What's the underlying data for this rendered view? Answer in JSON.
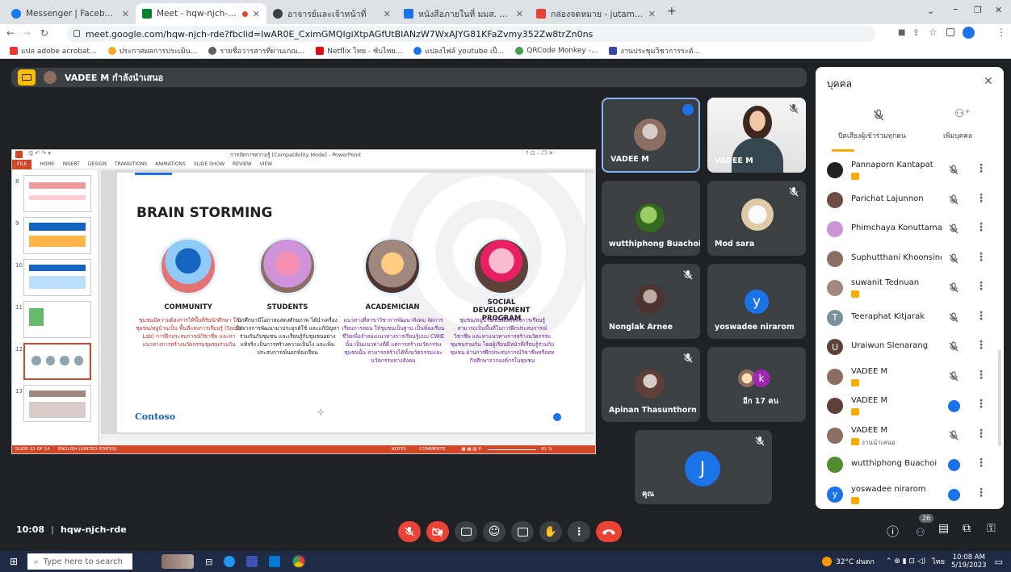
{
  "browser": {
    "tabs": [
      {
        "label": "Messenger | Facebook",
        "icon": "messenger-icon",
        "color": "#1877f2"
      },
      {
        "label": "Meet - hqw-njch-rde",
        "icon": "meet-icon",
        "color": "#00832d"
      },
      {
        "label": "อาจารย์และเจ้าหน้าที่",
        "icon": "site-icon",
        "color": "#3c4043"
      },
      {
        "label": "หนังสือภายในที่ มมส. 0733/2566 (คณ",
        "icon": "doc-icon",
        "color": "#1a73e8"
      },
      {
        "label": "กล่องจดหมาย - jutamas.chu@pcru",
        "icon": "gmail-icon",
        "color": "#ea4335"
      }
    ],
    "url": "meet.google.com/hqw-njch-rde?fbclid=IwAR0E_CximGMQlgiXtpAGfUtBIANzW7WxAJYG81KFaZvmy352Zw8trZn0ns",
    "bookmarks": [
      {
        "label": "แปล adobe acrobat...",
        "color": "#e53935"
      },
      {
        "label": "ประกาศผลการประเมิน...",
        "color": "#f9a825"
      },
      {
        "label": "รายชื่อวารสารที่ผ่านเกณ...",
        "color": "#616161"
      },
      {
        "label": "Netflix ไทย - ซับไทย...",
        "color": "#e50914"
      },
      {
        "label": "แปลงไฟล์ youtube เป็...",
        "color": "#1a73e8"
      },
      {
        "label": "QRCode Monkey -...",
        "color": "#43a047"
      },
      {
        "label": "งานประชุมวิชาการระดั...",
        "color": "#3949ab"
      }
    ]
  },
  "meet": {
    "presenter_label": "VADEE M กำลังนำเสนอ",
    "time": "10:08",
    "meeting_code": "hqw-njch-rde",
    "participant_count": "26",
    "tiles": [
      {
        "name": "VADEE M",
        "color": "#8d6e63"
      },
      {
        "name": "VADEE M",
        "color": "#5d4037"
      },
      {
        "name": "wutthiphong Buachoi",
        "color": "#558b2f"
      },
      {
        "name": "Mod sara",
        "color": "#e0c9a6"
      },
      {
        "name": "Nonglak Arnee",
        "color": "#6d4c41"
      },
      {
        "name": "yoswadee nirarom",
        "initial": "y",
        "color": "#1a73e8"
      },
      {
        "name": "Apinan Thasunthorn",
        "color": "#795548"
      },
      {
        "name": "อีก 17 คน",
        "initial": "k",
        "color": "#9c27b0"
      },
      {
        "name": "คุณ",
        "initial": "J",
        "color": "#1a73e8"
      }
    ]
  },
  "slide": {
    "window_title": "การจัดการความรู้ [Compatibility Mode] - PowerPoint",
    "ribbon": [
      "FILE",
      "HOME",
      "INSERT",
      "DESIGN",
      "TRANSITIONS",
      "ANIMATIONS",
      "SLIDE SHOW",
      "REVIEW",
      "VIEW"
    ],
    "thumb_numbers": [
      "8",
      "9",
      "10",
      "11",
      "12",
      "13"
    ],
    "title": "BRAIN STORMING",
    "columns": [
      {
        "heading": "COMMUNITY",
        "text": "ชุมชนมีความต้องการให้พื้นที่รับนักศึกษา ให้ชุมชน/หมู่บ้านเป็น พื้นที่แห่งการเรียนรู้ (Social Lab) การฝึกประสบการณ์วิชาชีพ และหาแนวทางการสร้างนวัตกรรมชุมชนร่วมกัน",
        "color": "#c62828"
      },
      {
        "heading": "STUDENTS",
        "text": "นักศึกษามีโอกาสแสดงศักยภาพ ได้นำเครื่องมือจากการพัฒนามาประยุกต์ใช้ และแก้ปัญหาร่วมกันกับชุมชน และเรียนรู้กับชุมชนอย่างแท้จริง เป็นการสร้างความเป็นไง และเพิ่มประสบการณ์นอกห้องเรียน",
        "color": "#202124"
      },
      {
        "heading": "ACADEMICIAN",
        "text": "แนวทางที่สาขาวิชาการพัฒนาสังคม จัดการเรียนการสอน ให้ชุมชนเป็นฐาน เป็นห้องเรียนชีวิตเพื่อจำลองแนวทางการเรียนรู้แบบ CWIE นั้น เป็นแนวทางที่ดี แต่การสร้างนวัตกรรมชุมชนนั้น สามารถสร้างได้ทั้งนวัตกรรมและนวัตกรรมทางสังคม",
        "color": "#6a1b9a"
      },
      {
        "heading": "SOCIAL DEVELOPMENT PROGRAM",
        "text": "ชุมชน/หมู่บ้านเป็นพื้นที่แห่งการเรียนรู้ สามารถเป็นพื้นที่ในการฝึกประสบการณ์วิชาชีพ และหาแนวทางการสร้างนวัตกรรมชุมชนร่วมกัน โดยผู้เรียนมีหน้าที่เรียนรู้ร่วมกับชุมชน ผ่านการฝึกประสบการณ์วิชาชีพหรือสหกิจศึกษาจากองค์กรในชุมชน",
        "color": "#6a1b9a"
      }
    ],
    "logo": "Contoso",
    "status_left": "SLIDE 12 OF 14",
    "status_lang": "ENGLISH (UNITED STATES)",
    "notes": "NOTES",
    "comments": "COMMENTS",
    "zoom": "81 %"
  },
  "people_panel": {
    "title": "บุคคล",
    "mute_all": "ปิดเสียงผู้เข้าร่วมทุกคน",
    "add_people": "เพิ่มบุคคล",
    "participants": [
      {
        "name": "Pannaporn Kantapat",
        "sub": "",
        "state": "muted",
        "color": "#212121",
        "initial": ""
      },
      {
        "name": "Parichat Lajunnon",
        "sub": "",
        "state": "muted",
        "color": "#6d4c41",
        "initial": ""
      },
      {
        "name": "Phimchaya Konuttama",
        "sub": "",
        "state": "muted",
        "color": "#ce93d8",
        "initial": ""
      },
      {
        "name": "Suphutthani Khoonsingsa...",
        "sub": "",
        "state": "muted",
        "color": "#8d6e63",
        "initial": ""
      },
      {
        "name": "suwanit Tednuan",
        "sub": "",
        "state": "muted",
        "color": "#a1887f",
        "initial": ""
      },
      {
        "name": "Teeraphat Kitjarak",
        "sub": "",
        "state": "muted",
        "color": "#78909c",
        "initial": "T"
      },
      {
        "name": "Uraiwun Slenarang",
        "sub": "",
        "state": "muted",
        "color": "#5d4037",
        "initial": "U"
      },
      {
        "name": "VADEE M",
        "sub": "",
        "state": "muted",
        "color": "#8d6e63",
        "initial": ""
      },
      {
        "name": "VADEE M",
        "sub": "",
        "state": "speaking",
        "color": "#5d4037",
        "initial": ""
      },
      {
        "name": "VADEE M",
        "sub": "งานนำเสนอ",
        "state": "present",
        "color": "#8d6e63",
        "initial": ""
      },
      {
        "name": "wutthiphong Buachoi",
        "sub": "",
        "state": "idle",
        "color": "#558b2f",
        "initial": ""
      },
      {
        "name": "yoswadee nirarom",
        "sub": "",
        "state": "idle",
        "color": "#1a73e8",
        "initial": "y"
      }
    ]
  },
  "taskbar": {
    "search_placeholder": "Type here to search",
    "weather": "32°C ฝนตก",
    "lang": "ไทย",
    "clock": "10:08 AM",
    "date": "5/19/2023"
  }
}
